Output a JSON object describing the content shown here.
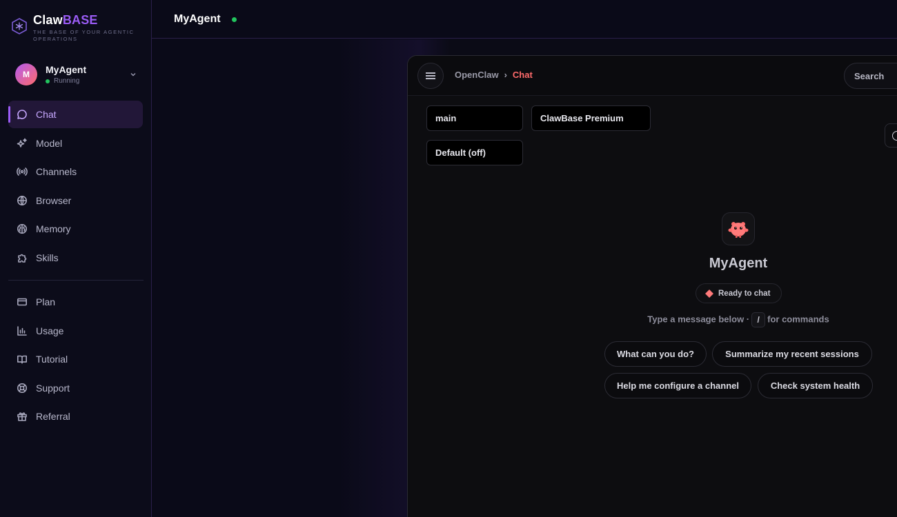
{
  "brand": {
    "name_part1": "Claw",
    "name_part2": "BASE",
    "tagline": "THE BASE OF YOUR AGENTIC OPERATIONS"
  },
  "agent": {
    "initial": "M",
    "name": "MyAgent",
    "status": "Running"
  },
  "sidebar": {
    "primary": [
      {
        "label": "Chat",
        "icon": "chat-bubble-icon",
        "active": true
      },
      {
        "label": "Model",
        "icon": "sparkles-icon"
      },
      {
        "label": "Channels",
        "icon": "broadcast-icon"
      },
      {
        "label": "Browser",
        "icon": "globe-icon"
      },
      {
        "label": "Memory",
        "icon": "brain-icon"
      },
      {
        "label": "Skills",
        "icon": "puzzle-icon"
      }
    ],
    "secondary": [
      {
        "label": "Plan",
        "icon": "credit-card-icon"
      },
      {
        "label": "Usage",
        "icon": "bar-chart-icon"
      },
      {
        "label": "Tutorial",
        "icon": "book-icon"
      },
      {
        "label": "Support",
        "icon": "lifebuoy-icon"
      },
      {
        "label": "Referral",
        "icon": "gift-icon"
      }
    ]
  },
  "header": {
    "title": "MyAgent"
  },
  "chat": {
    "breadcrumb": {
      "root": "OpenClaw",
      "separator": "›",
      "current": "Chat"
    },
    "search_label": "Search",
    "session_select": "main",
    "model_select": "ClawBase Premium",
    "thinking_select": "Default (off)",
    "welcome": {
      "title": "MyAgent",
      "badge": "Ready to chat",
      "hint_before": "Type a message below ·",
      "hint_key": "/",
      "hint_after": "for commands"
    },
    "suggestions": [
      "What can you do?",
      "Summarize my recent sessions",
      "Help me configure a channel",
      "Check system health"
    ]
  },
  "colors": {
    "accent": "#9b5cf6",
    "crumb_active": "#ff6b6b",
    "status_online": "#22c55e"
  }
}
